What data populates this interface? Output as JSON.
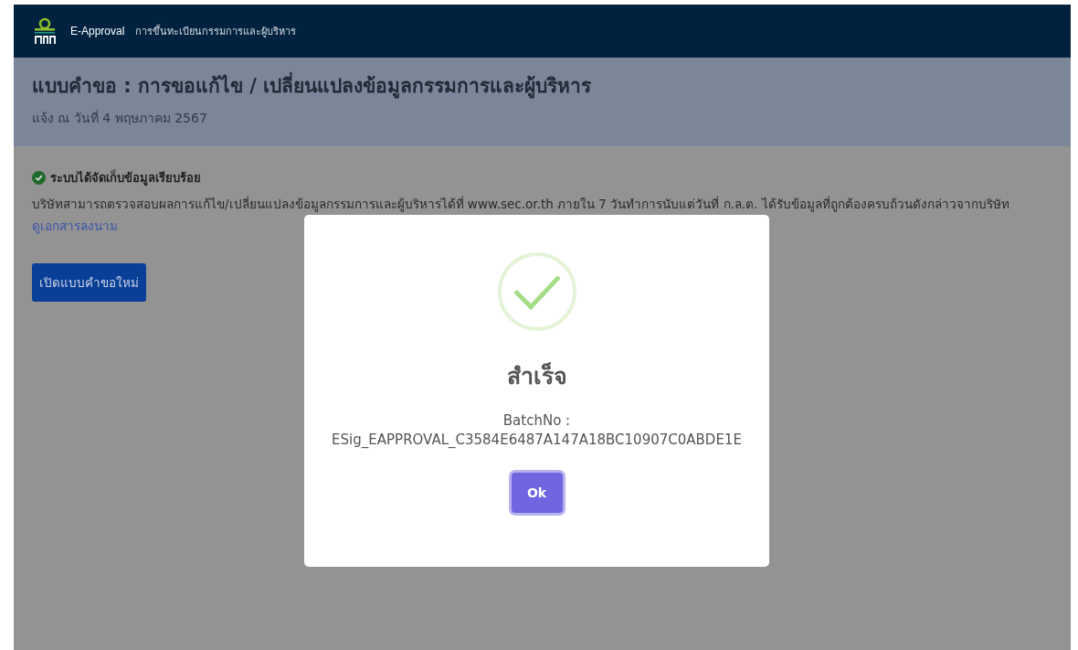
{
  "header": {
    "app_name": "E-Approval",
    "section": "การขึ้นทะเบียนกรรมการและผู้บริหาร"
  },
  "page": {
    "title": "แบบคำขอ : การขอแก้ไข / เปลี่ยนแปลงข้อมูลกรรมการและผู้บริหาร",
    "subtitle": "แจ้ง ณ วันที่ 4 พฤษภาคม 2567"
  },
  "notice": {
    "heading": "ระบบได้จัดเก็บข้อมูลเรียบร้อย",
    "body": "บริษัทสามารถตรวจสอบผลการแก้ไข/เปลี่ยนแปลงข้อมูลกรรมการและผู้บริหารได้ที่ www.sec.or.th ภายใน 7 วันทำการนับแต่วันที่ ก.ล.ต. ได้รับข้อมูลที่ถูกต้องครบถ้วนดังกล่าวจากบริษัท",
    "link": "ดูเอกสารลงนาม"
  },
  "new_request_button": "เปิดแบบคำขอใหม่",
  "dialog": {
    "title": "สำเร็จ",
    "label": "BatchNo :",
    "batch_no": "ESig_EAPPROVAL_C3584E6487A147A18BC10907C0ABDE1E",
    "button": "Ok"
  }
}
